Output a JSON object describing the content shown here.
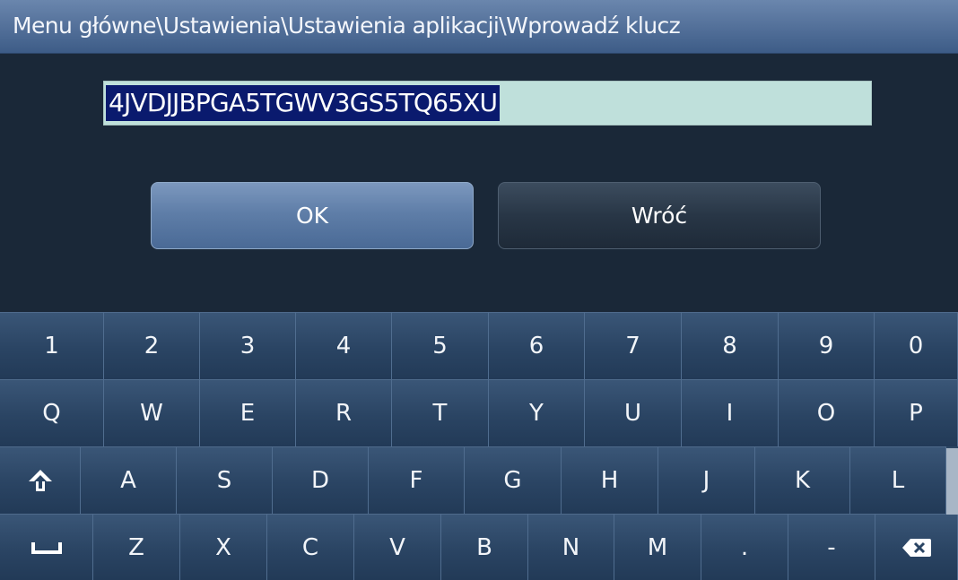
{
  "titlebar": {
    "breadcrumb": "Menu główne\\Ustawienia\\Ustawienia aplikacji\\Wprowadź klucz"
  },
  "key_input": {
    "value": "4JVDJJBPGA5TGWV3GS5TQ65XU"
  },
  "buttons": {
    "ok": "OK",
    "back": "Wróć"
  },
  "keyboard": {
    "row1": [
      "1",
      "2",
      "3",
      "4",
      "5",
      "6",
      "7",
      "8",
      "9",
      "0"
    ],
    "row2": [
      "Q",
      "W",
      "E",
      "R",
      "T",
      "Y",
      "U",
      "I",
      "O",
      "P"
    ],
    "row3": [
      "A",
      "S",
      "D",
      "F",
      "G",
      "H",
      "J",
      "K",
      "L"
    ],
    "row4": [
      "Z",
      "X",
      "C",
      "V",
      "B",
      "N",
      "M",
      ".",
      "-"
    ],
    "icons": {
      "shift": "shift-arrow-icon",
      "space": "space-bar-icon",
      "backspace": "backspace-icon"
    }
  },
  "colors": {
    "background": "#1a2838",
    "title_bar": "#56739c",
    "input_background": "#bfe0db",
    "selection": "#0a1a6e",
    "ok_button": "#5f7ea8",
    "back_button": "#283646",
    "key": "#2a4463"
  }
}
